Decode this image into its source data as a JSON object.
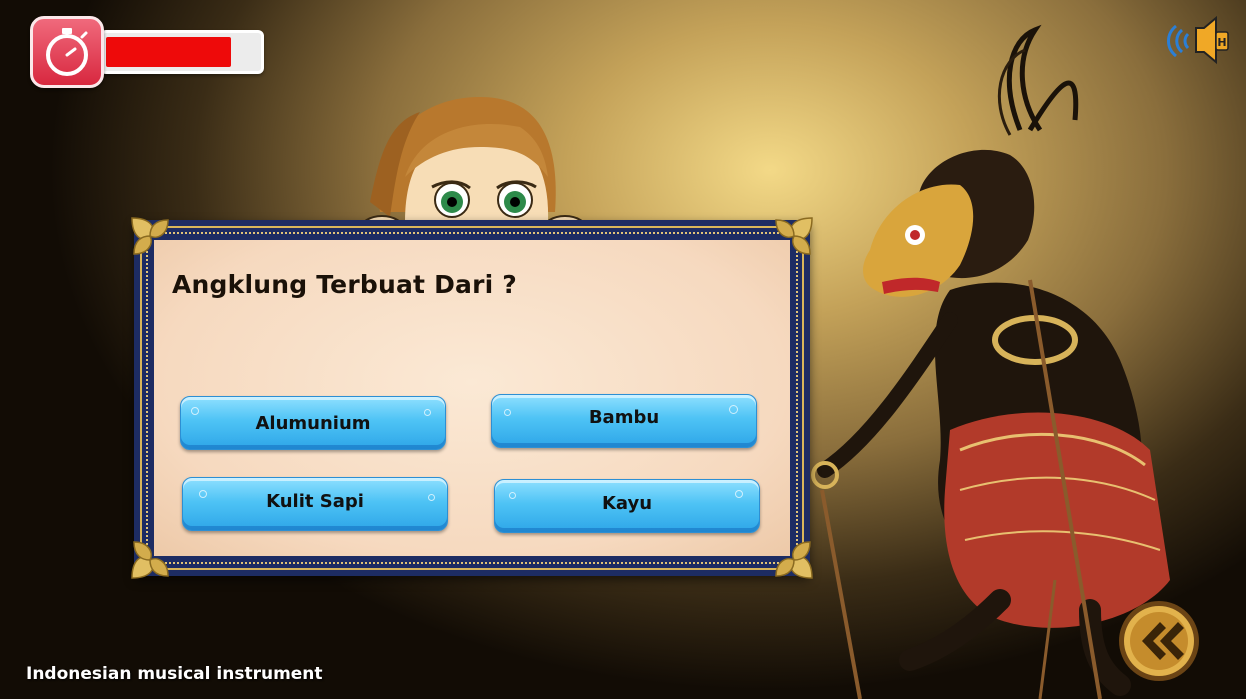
{
  "hud": {
    "timer_progress": 0.82,
    "timer_icon": "stopwatch-icon",
    "sound_icon": "speaker-icon",
    "colors": {
      "timer_fill": "#ee0a0a",
      "timer_badge": "#e0354b"
    }
  },
  "question": {
    "text": "Angklung Terbuat Dari ?"
  },
  "answers": [
    {
      "label": "Alumunium"
    },
    {
      "label": "Bambu"
    },
    {
      "label": "Kulit Sapi"
    },
    {
      "label": "Kayu"
    }
  ],
  "navigation": {
    "back_icon": "double-chevron-left-icon"
  },
  "footer": {
    "caption": "Indonesian musical instrument"
  },
  "colors": {
    "board_frame": "#1d2c63",
    "board_paper": "#f8e0c8",
    "answer_button": "#4ec3f5"
  }
}
